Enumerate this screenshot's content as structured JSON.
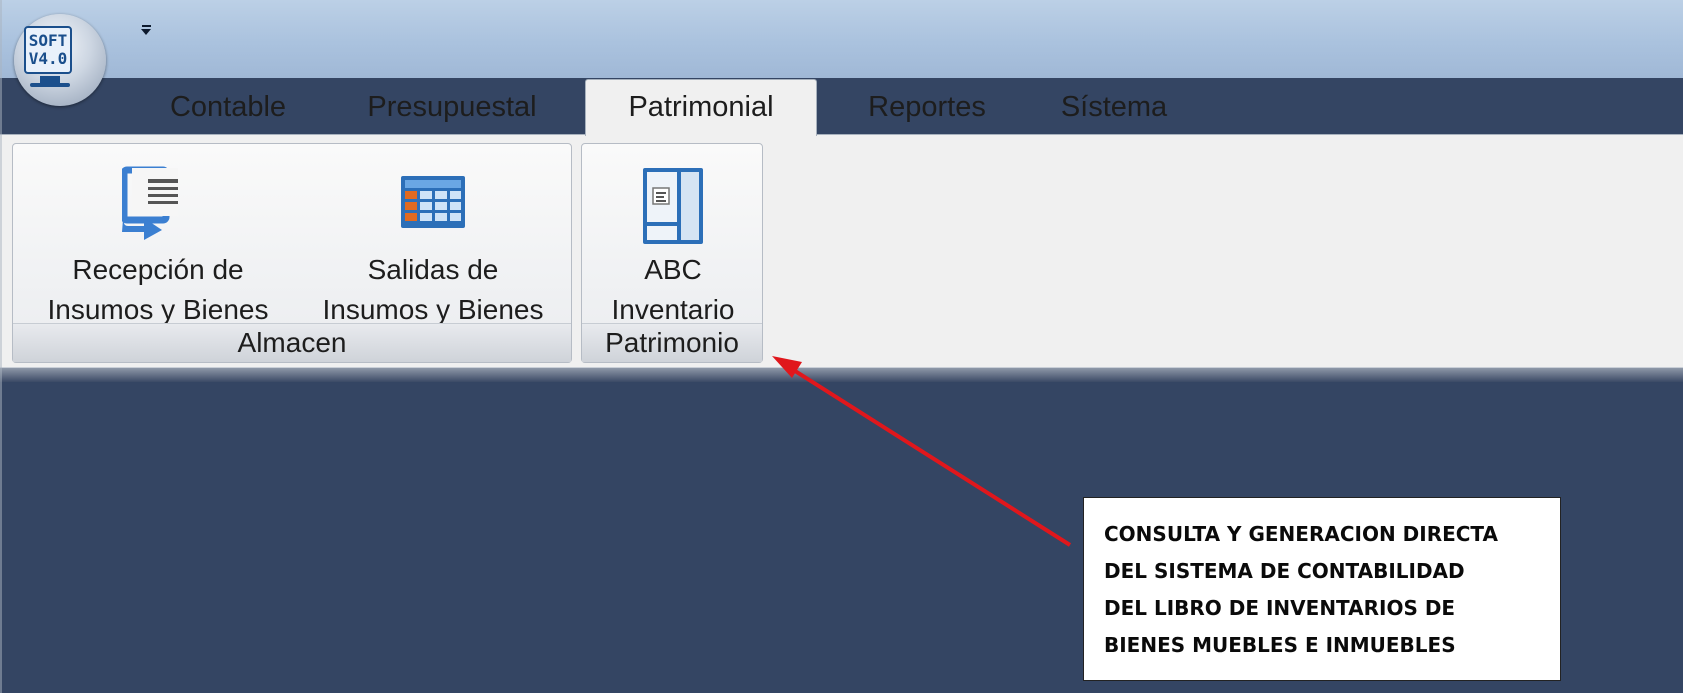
{
  "app": {
    "logo_line1": "SOFT",
    "logo_line2": "V4.0"
  },
  "tabs": [
    {
      "label": "Contable",
      "active": false
    },
    {
      "label": "Presupuestal",
      "active": false
    },
    {
      "label": "Patrimonial",
      "active": true
    },
    {
      "label": "Reportes",
      "active": false
    },
    {
      "label": "Sístema",
      "active": false
    }
  ],
  "ribbon": {
    "groups": [
      {
        "label": "Almacen",
        "buttons": [
          {
            "line1": "Recepción de",
            "line2": "Insumos y Bienes",
            "icon": "receive-document-icon"
          },
          {
            "line1": "Salidas de",
            "line2": "Insumos y Bienes",
            "icon": "table-grid-icon"
          }
        ]
      },
      {
        "label": "Patrimonio",
        "buttons": [
          {
            "line1": "ABC",
            "line2": "Inventario",
            "icon": "inventory-panel-icon"
          }
        ]
      }
    ]
  },
  "callout": {
    "lines": [
      "CONSULTA Y GENERACION DIRECTA",
      "DEL SISTEMA DE CONTABILIDAD",
      "DEL LIBRO DE INVENTARIOS DE",
      "BIENES MUEBLES E INMUEBLES"
    ],
    "arrow_color": "#e0171c"
  },
  "colors": {
    "workspace": "#344563",
    "titlebar": "#aac2de",
    "ribbon": "#f0f0f0",
    "accent_blue": "#3b7fd1"
  }
}
